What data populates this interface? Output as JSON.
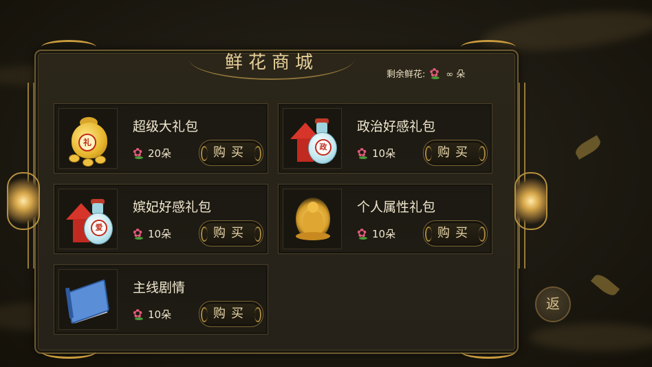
{
  "shop": {
    "title": "鲜花商城",
    "remaining_label": "剩余鲜花:",
    "remaining_value": "∞ 朵"
  },
  "items": [
    {
      "name": "超级大礼包",
      "price": "20朵",
      "buy_label": "购买",
      "icon": "gold-bag-icon",
      "seal": "礼"
    },
    {
      "name": "政治好感礼包",
      "price": "10朵",
      "buy_label": "购买",
      "icon": "politics-bottle-icon",
      "seal": "政"
    },
    {
      "name": "嫔妃好感礼包",
      "price": "10朵",
      "buy_label": "购买",
      "icon": "love-bottle-icon",
      "seal": "爱"
    },
    {
      "name": "个人属性礼包",
      "price": "10朵",
      "buy_label": "购买",
      "icon": "golden-buddha-icon"
    },
    {
      "name": "主线剧情",
      "price": "10朵",
      "buy_label": "购买",
      "icon": "blue-book-icon"
    }
  ],
  "back_button": {
    "label": "返"
  },
  "colors": {
    "accent_gold": "#c99b3e",
    "title_text": "#e6cf99",
    "flower_pink": "#e45a7a",
    "arrow_red": "#d8352a"
  }
}
